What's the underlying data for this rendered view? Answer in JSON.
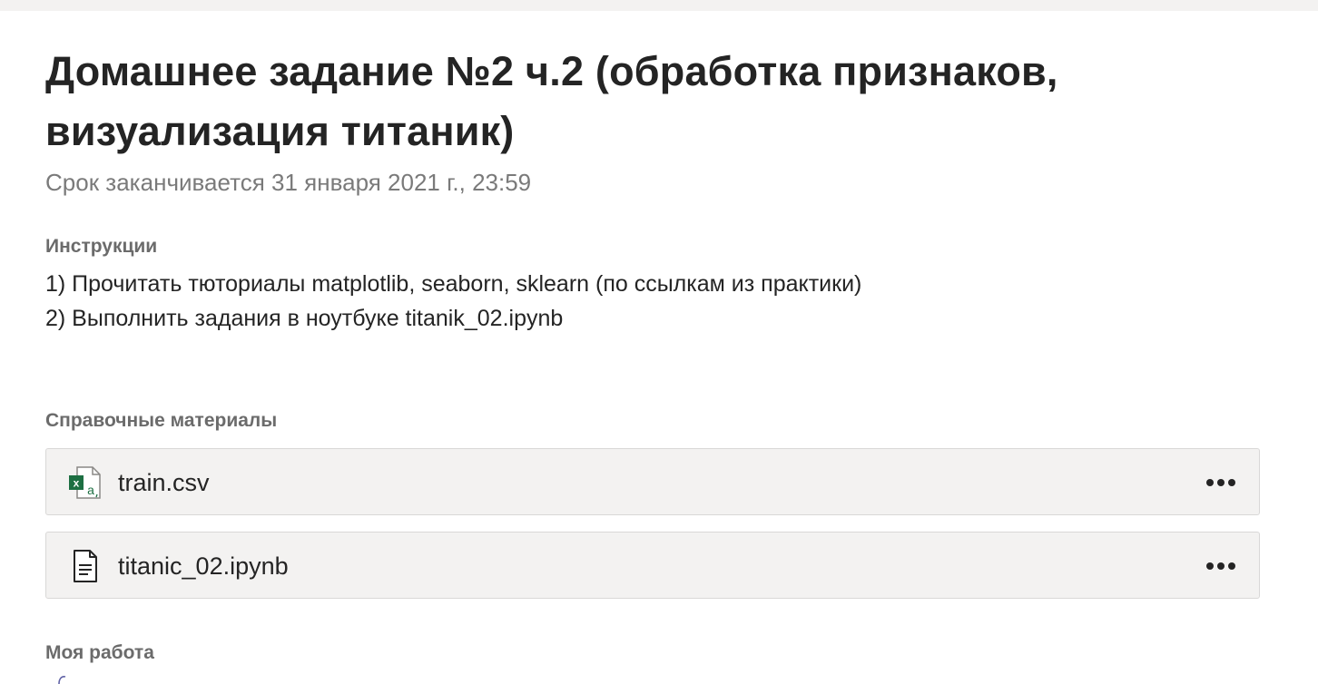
{
  "assignment": {
    "title": "Домашнее задание №2 ч.2 (обработка признаков, визуализация титаник)",
    "due": "Срок заканчивается 31 января 2021 г., 23:59"
  },
  "instructions": {
    "label": "Инструкции",
    "lines": [
      "1) Прочитать тюториалы matplotlib, seaborn, sklearn (по ссылкам из практики)",
      "2) Выполнить задания в ноутбуке titanik_02.ipynb"
    ]
  },
  "references": {
    "label": "Справочные материалы",
    "files": [
      {
        "name": "train.csv",
        "icon": "excel-csv-icon"
      },
      {
        "name": "titanic_02.ipynb",
        "icon": "document-icon"
      }
    ]
  },
  "my_work": {
    "label": "Моя работа"
  },
  "colors": {
    "excel_green": "#1d6f42",
    "card_background": "#f3f2f1",
    "secondary_text": "#7a7a7a"
  }
}
